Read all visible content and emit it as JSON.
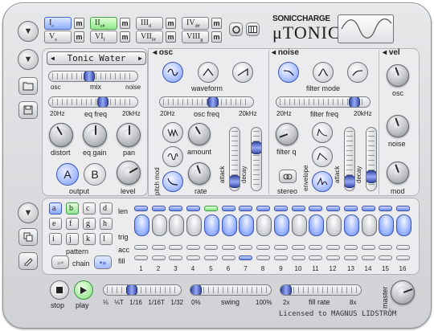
{
  "brand": {
    "maker": "SONICCHARGE",
    "product": "μTONIC",
    "tagline": "Licensed to MAGNUS LIDSTRÖM"
  },
  "channels": [
    {
      "label": "I",
      "sub": "c",
      "state": "selected"
    },
    {
      "label": "II",
      "sub": "c#",
      "state": "playing"
    },
    {
      "label": "III",
      "sub": "d",
      "state": "normal"
    },
    {
      "label": "IV",
      "sub": "d#",
      "state": "normal"
    },
    {
      "label": "V",
      "sub": "e",
      "state": "normal"
    },
    {
      "label": "VI",
      "sub": "f",
      "state": "normal"
    },
    {
      "label": "VII",
      "sub": "f#",
      "state": "normal"
    },
    {
      "label": "VIII",
      "sub": "g",
      "state": "normal"
    }
  ],
  "mute_label": "m",
  "colors": {
    "accent": "#7d9cff",
    "active_green": "#94e48f",
    "chassis": "#d9dadd"
  },
  "patch": {
    "name": "Tonic Water"
  },
  "mix": {
    "left": "osc",
    "label": "mix",
    "right": "noise",
    "value": 0.45
  },
  "eq": {
    "left": "20Hz",
    "label": "eq freq",
    "right": "20kHz",
    "value": 0.62
  },
  "knobs_left": {
    "distort": "distort",
    "eq_gain": "eq gain",
    "pan": "pan",
    "level": "level"
  },
  "output": {
    "label": "output",
    "a": "A",
    "b": "B",
    "selected": "A"
  },
  "osc": {
    "title": "osc",
    "waveform_label": "waveform",
    "waveforms": [
      "sine-wave-icon",
      "triangle-wave-icon",
      "saw-wave-icon"
    ],
    "selected": 0,
    "freq": {
      "left": "20Hz",
      "label": "osc freq",
      "right": "20kHz",
      "value": 0.58
    },
    "pitch_mod_label": "pitch mod",
    "amount_label": "amount",
    "rate_label": "rate",
    "attack_label": "attack",
    "decay_label": "decay",
    "attack": 0.05,
    "decay": 0.72
  },
  "noise": {
    "title": "noise",
    "filter_mode_label": "filter mode",
    "modes": [
      "lowpass-icon",
      "bandpass-icon",
      "highpass-icon"
    ],
    "selected": 0,
    "freq": {
      "left": "20Hz",
      "label": "filter freq",
      "right": "20kHz",
      "value": 0.88
    },
    "filter_q_label": "filter q",
    "envelope_label": "envelope",
    "stereo_label": "stereo",
    "attack_label": "attack",
    "decay_label": "decay",
    "attack": 0.05,
    "decay": 0.15
  },
  "vel": {
    "title": "vel",
    "osc": "osc",
    "noise": "noise",
    "mod": "mod"
  },
  "pattern": {
    "label": "pattern",
    "letters": [
      "a",
      "b",
      "c",
      "d",
      "e",
      "f",
      "g",
      "h",
      "i",
      "j",
      "k",
      "l"
    ],
    "selected": "a",
    "current": "b",
    "chain_label": "chain"
  },
  "sequencer": {
    "rows": {
      "len": "len",
      "trig": "trig",
      "acc": "acc",
      "fill": "fill"
    },
    "steps": [
      "1",
      "2",
      "3",
      "4",
      "5",
      "6",
      "7",
      "8",
      "9",
      "10",
      "11",
      "12",
      "13",
      "14",
      "15",
      "16"
    ],
    "trig_on": [
      1,
      0,
      0,
      0,
      1,
      1,
      1,
      0,
      1,
      0,
      1,
      0,
      1,
      0,
      1,
      1
    ],
    "acc_on": [
      0,
      0,
      0,
      0,
      0,
      0,
      0,
      0,
      0,
      0,
      0,
      0,
      0,
      0,
      0,
      0
    ],
    "fill_on": [
      0,
      0,
      0,
      0,
      0,
      0,
      1,
      0,
      0,
      0,
      0,
      0,
      0,
      0,
      0,
      0
    ],
    "len_active_step": 5
  },
  "transport": {
    "stop": "stop",
    "play": "play",
    "rate_ticks": [
      "⅛",
      "⅛T",
      "1/16",
      "1/16T",
      "1/32"
    ],
    "swing": {
      "left": "0%",
      "label": "swing",
      "right": "100%",
      "value": 0.0
    },
    "fill_rate": {
      "left": "2x",
      "label": "fill rate",
      "right": "8x",
      "value": 0.0
    },
    "master": "master"
  }
}
